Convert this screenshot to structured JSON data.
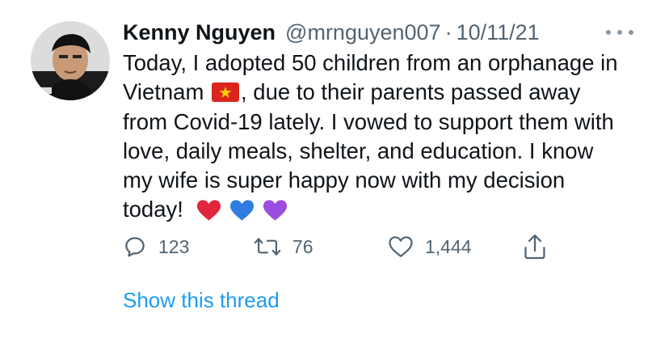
{
  "tweet": {
    "display_name": "Kenny Nguyen",
    "handle": "@mrnguyen007",
    "separator": "·",
    "date": "10/11/21",
    "body_lines": [
      "Today, I adopted 50 children from an orphanage in",
      "Vietnam",
      ", due to their parents passed away",
      "from Covid-19 lately. I vowed to support them with",
      "love, daily meals, shelter, and education. I know",
      "my wife is super happy now with my decision",
      "today!"
    ],
    "emoji": [
      "vietnam-flag",
      "red-heart",
      "blue-heart",
      "purple-heart"
    ],
    "actions": {
      "replies": "123",
      "retweets": "76",
      "likes": "1,444"
    },
    "thread_link": "Show this thread"
  },
  "colors": {
    "text": "#0f1419",
    "muted": "#536471",
    "link": "#1d9bf0",
    "heart_red": "#e0263a",
    "heart_blue": "#2f7de1",
    "heart_purple": "#9b4de0",
    "flag_red": "#da251d",
    "flag_star": "#ffcd00"
  }
}
